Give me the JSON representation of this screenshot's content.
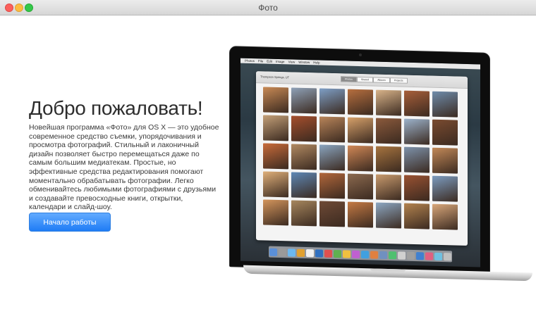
{
  "window": {
    "title": "Фото"
  },
  "welcome": {
    "heading": "Добро пожаловать!",
    "description": "Новейшая программа «Фото» для OS X — это удобное современное средство съемки, упорядочивания и просмотра фотографий. Стильный и лаконичный дизайн позволяет быстро перемещаться даже по самым большим медиатекам. Простые, но эффективные средства редактирования помогают моментально обрабатывать фотографии. Легко обменивайтесь любимыми фотографиями с друзьями и создавайте превосходные книги, открытки, календари и слайд-шоу.",
    "button_label": "Начало работы"
  },
  "screen": {
    "menubar": [
      "Photos",
      "File",
      "Edit",
      "Image",
      "View",
      "Window",
      "Help"
    ],
    "location": "Thompson Springs, UT",
    "tabs": [
      "Photos",
      "Shared",
      "Albums",
      "Projects"
    ],
    "active_tab": 0
  },
  "thumb_colors": [
    "#c98a55",
    "#8fa2b8",
    "#7e9fc6",
    "#b76f3f",
    "#d9b48a",
    "#a85f3a",
    "#6e8cab",
    "#c4a078",
    "#a64f2d",
    "#b9855a",
    "#d7a16a",
    "#8b5a3c",
    "#9cb3cc",
    "#7a4b30",
    "#c96b3a",
    "#b28a62",
    "#8aa5c0",
    "#d18856",
    "#a7743f",
    "#7d92ab",
    "#c38958",
    "#e0b07a",
    "#5e88b6",
    "#b2673b",
    "#8c6a4f",
    "#c99b6e",
    "#9a5232",
    "#7c9cc0",
    "#d4955c",
    "#a7875e",
    "#6f4a36",
    "#c57a44",
    "#8da8c3",
    "#b3834f",
    "#d9a77a"
  ],
  "dock_colors": [
    "#5a8fd8",
    "#9a9a9a",
    "#6bb8f0",
    "#e0a030",
    "#f0f0f0",
    "#3070c0",
    "#e05050",
    "#60b050",
    "#f0c040",
    "#c060d0",
    "#40a0e0",
    "#e08040",
    "#7090c0",
    "#50c070",
    "#d0d0d0",
    "#a0a0a0",
    "#4080d0",
    "#e06080",
    "#70c0e0",
    "#c0c0c0"
  ]
}
